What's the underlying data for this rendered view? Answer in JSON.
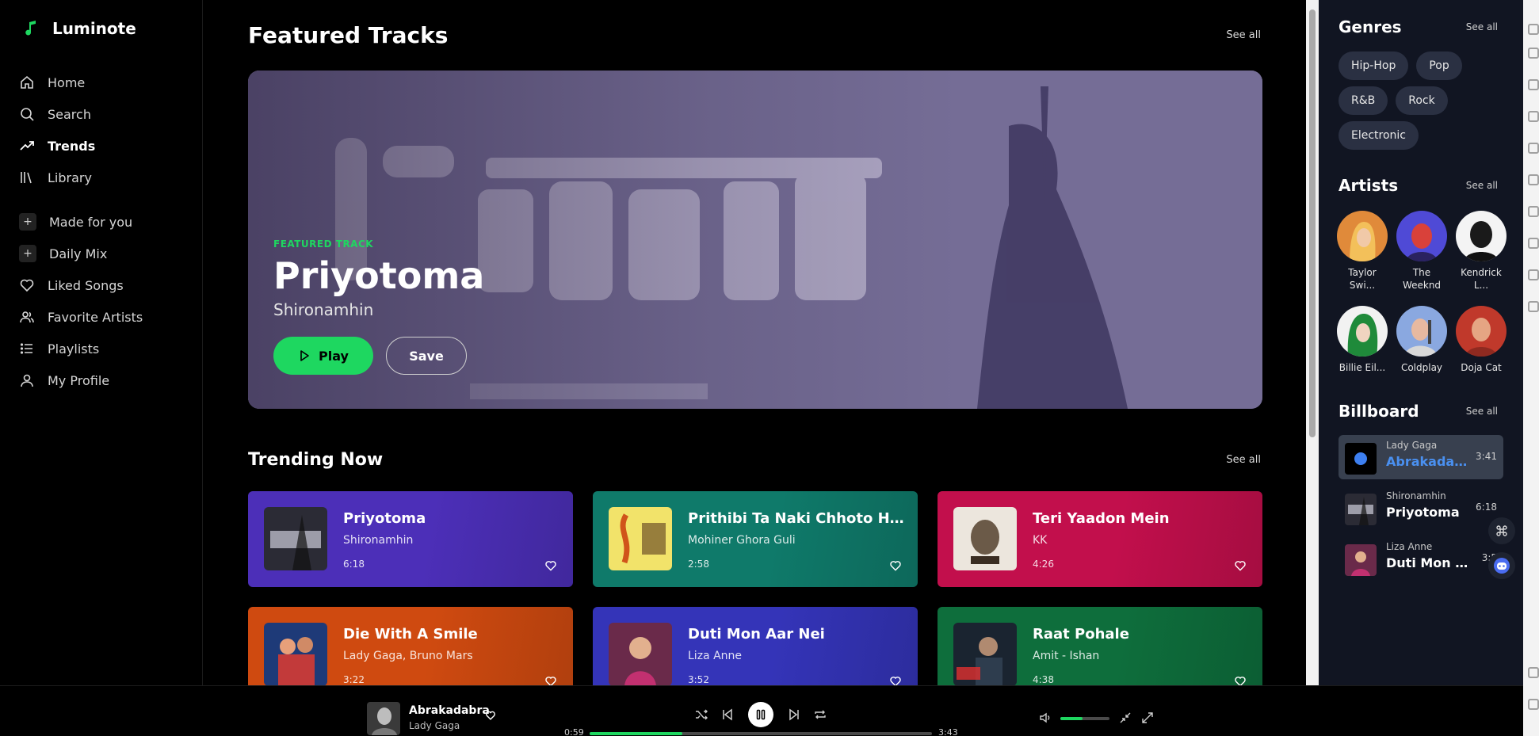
{
  "app": {
    "name": "Luminote"
  },
  "nav": {
    "primary": [
      {
        "label": "Home",
        "icon": "home-icon"
      },
      {
        "label": "Search",
        "icon": "search-icon"
      },
      {
        "label": "Trends",
        "icon": "trending-icon",
        "active": true
      },
      {
        "label": "Library",
        "icon": "library-icon"
      }
    ],
    "secondary": [
      {
        "label": "Made for you",
        "icon": "plus-icon"
      },
      {
        "label": "Daily Mix",
        "icon": "plus-icon"
      },
      {
        "label": "Liked Songs",
        "icon": "heart-icon"
      },
      {
        "label": "Favorite Artists",
        "icon": "users-icon"
      },
      {
        "label": "Playlists",
        "icon": "list-icon"
      },
      {
        "label": "My Profile",
        "icon": "user-icon"
      }
    ]
  },
  "featured": {
    "heading": "Featured Tracks",
    "see_all": "See all",
    "label": "FEATURED TRACK",
    "title": "Priyotoma",
    "artist": "Shironamhin",
    "play_label": "Play",
    "save_label": "Save"
  },
  "trending": {
    "heading": "Trending Now",
    "see_all": "See all",
    "tracks": [
      {
        "title": "Priyotoma",
        "artist": "Shironamhin",
        "duration": "6:18",
        "color": "#4c2fb8"
      },
      {
        "title": "Prithibi Ta Naki Chhoto Hote Hote",
        "artist": "Mohiner Ghora Guli",
        "duration": "2:58",
        "color": "#0f7a6a"
      },
      {
        "title": "Teri Yaadon Mein",
        "artist": "KK",
        "duration": "4:26",
        "color": "#c20f4c"
      },
      {
        "title": "Die With A Smile",
        "artist": "Lady Gaga, Bruno Mars",
        "duration": "3:22",
        "color": "#cf4a10"
      },
      {
        "title": "Duti Mon Aar Nei",
        "artist": "Liza Anne",
        "duration": "3:52",
        "color": "#3434b8"
      },
      {
        "title": "Raat Pohale",
        "artist": "Amit - Ishan",
        "duration": "4:38",
        "color": "#0e6e3c"
      }
    ]
  },
  "genres": {
    "heading": "Genres",
    "see_all": "See all",
    "items": [
      "Hip-Hop",
      "Pop",
      "R&B",
      "Rock",
      "Electronic"
    ]
  },
  "artists": {
    "heading": "Artists",
    "see_all": "See all",
    "items": [
      {
        "name1": "Taylor",
        "name2": "Swi..."
      },
      {
        "name1": "The",
        "name2": "Weeknd"
      },
      {
        "name1": "Kendrick",
        "name2": "L..."
      },
      {
        "name1": "Billie Eil...",
        "name2": ""
      },
      {
        "name1": "Coldplay",
        "name2": ""
      },
      {
        "name1": "Doja Cat",
        "name2": ""
      }
    ]
  },
  "billboard": {
    "heading": "Billboard",
    "see_all": "See all",
    "items": [
      {
        "artist": "Lady Gaga",
        "title": "Abrakadabra",
        "duration": "3:41",
        "active": true
      },
      {
        "artist": "Shironamhin",
        "title": "Priyotoma",
        "duration": "6:18"
      },
      {
        "artist": "Liza Anne",
        "title": "Duti Mon A...",
        "duration": "3:5"
      }
    ]
  },
  "player": {
    "title": "Abrakadabra",
    "artist": "Lady Gaga",
    "elapsed": "0:59",
    "total": "3:43",
    "progress": 0.27,
    "volume": 0.45
  },
  "colors": {
    "accent": "#1ed760",
    "active_title": "#4a90f0"
  }
}
